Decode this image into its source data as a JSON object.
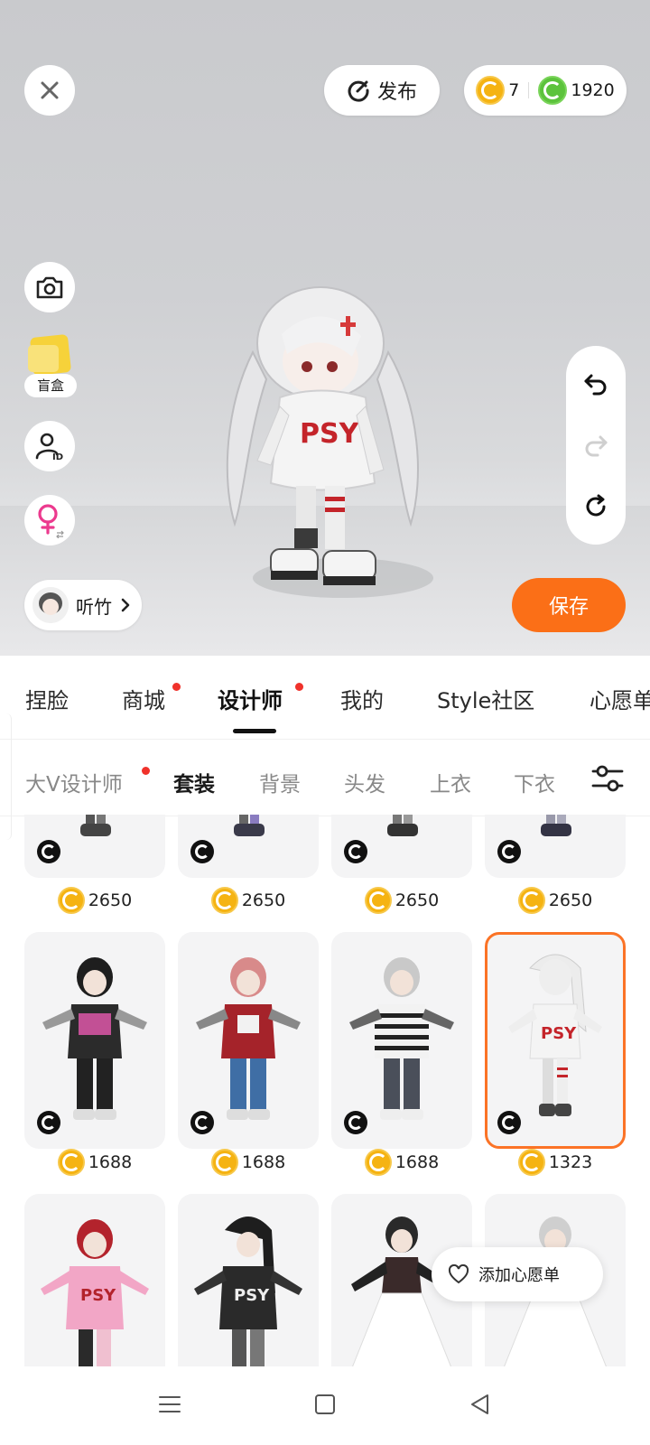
{
  "header": {
    "close_icon": "close-icon",
    "publish_label": "发布",
    "currency_gold": "7",
    "currency_green": "1920"
  },
  "left_tools": {
    "blindbox_label": "盲盒",
    "profile_name": "听竹"
  },
  "save_label": "保存",
  "main_tabs": [
    {
      "label": "捏脸",
      "dot": false
    },
    {
      "label": "商城",
      "dot": true
    },
    {
      "label": "设计师",
      "dot": true,
      "active": true
    },
    {
      "label": "我的",
      "dot": false
    },
    {
      "label": "Style社区",
      "dot": false
    },
    {
      "label": "心愿单",
      "dot": false
    }
  ],
  "sub_tabs": [
    {
      "label": "大V设计师",
      "dot": true
    },
    {
      "label": "套装",
      "active": true
    },
    {
      "label": "背景"
    },
    {
      "label": "头发"
    },
    {
      "label": "上衣"
    },
    {
      "label": "下衣"
    }
  ],
  "grid": {
    "row1_prices": [
      "2650",
      "2650",
      "2650",
      "2650"
    ],
    "row2_prices": [
      "1688",
      "1688",
      "1688",
      "1323"
    ],
    "selected_index": 3
  },
  "wishlist_label": "添加心愿单",
  "colors": {
    "accent": "#fb6f17",
    "gold_coin": "#f5b312",
    "green_coin": "#5cc33c",
    "dot": "#f0322b"
  }
}
